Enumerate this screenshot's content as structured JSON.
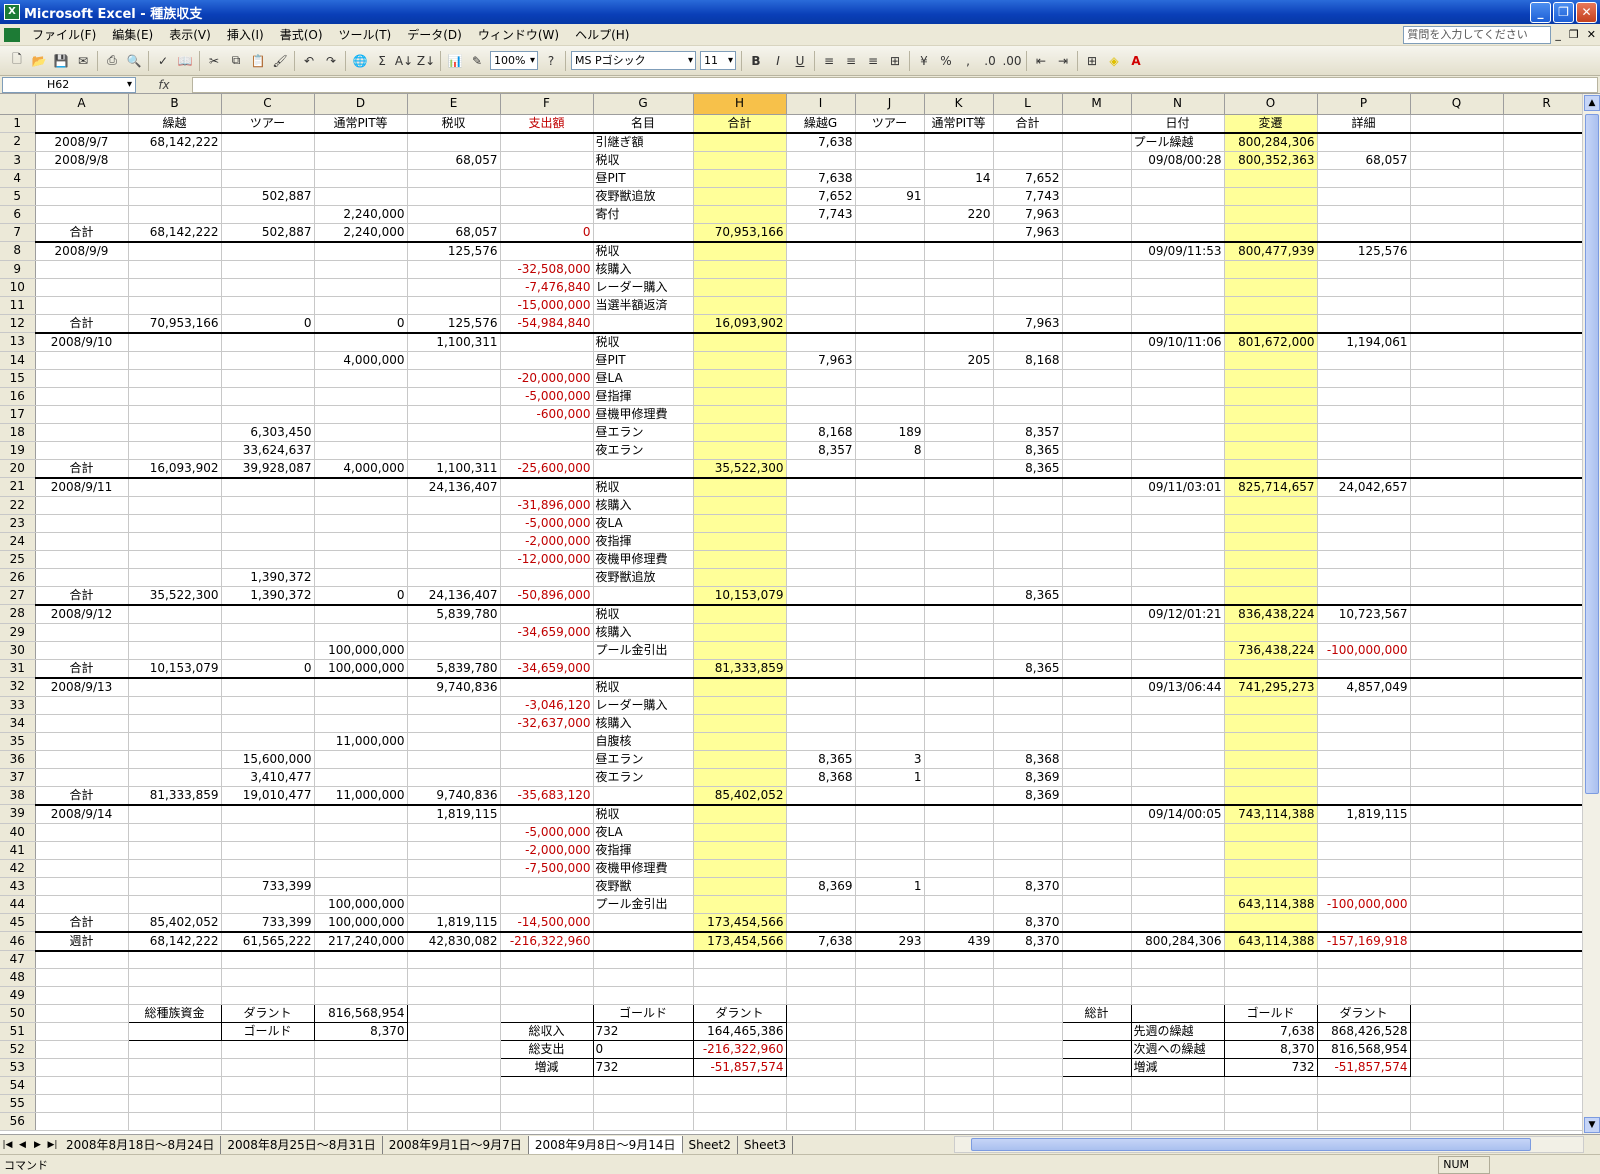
{
  "titlebar": {
    "title": "Microsoft Excel - 種族収支",
    "icon": "excel-icon"
  },
  "menu": [
    "ファイル(F)",
    "編集(E)",
    "表示(V)",
    "挿入(I)",
    "書式(O)",
    "ツール(T)",
    "データ(D)",
    "ウィンドウ(W)",
    "ヘルプ(H)"
  ],
  "help_placeholder": "質問を入力してください",
  "toolbar": {
    "zoom": "100%",
    "font": "MS Pゴシック",
    "font_size": "11",
    "sigma": "Σ",
    "percent": "%",
    "comma": ","
  },
  "namebox": "H62",
  "fx": "fx",
  "columns": [
    "A",
    "B",
    "C",
    "D",
    "E",
    "F",
    "G",
    "H",
    "I",
    "J",
    "K",
    "L",
    "M",
    "N",
    "O",
    "P",
    "Q",
    "R"
  ],
  "rows": [
    {
      "n": 1,
      "A": "",
      "B": "繰越",
      "C": "ツアー",
      "D": "通常PIT等",
      "E": "税収",
      "F": "支出額",
      "G": "名目",
      "H": "合計",
      "I": "繰越G",
      "J": "ツアー",
      "K": "通常PIT等",
      "L": "合計",
      "N": "日付",
      "O": "変遷",
      "P": "詳細"
    },
    {
      "n": 2,
      "A": "2008/9/7",
      "B": "68,142,222",
      "G": "引継ぎ額",
      "I": "7,638",
      "N": "プール繰越",
      "O": "800,284,306"
    },
    {
      "n": 3,
      "A": "2008/9/8",
      "E": "68,057",
      "G": "税収",
      "N": "09/08/00:28",
      "O": "800,352,363",
      "P": "68,057"
    },
    {
      "n": 4,
      "G": "昼PIT",
      "I": "7,638",
      "K": "14",
      "L": "7,652"
    },
    {
      "n": 5,
      "C": "502,887",
      "G": "夜野獣追放",
      "I": "7,652",
      "J": "91",
      "L": "7,743"
    },
    {
      "n": 6,
      "D": "2,240,000",
      "G": "寄付",
      "I": "7,743",
      "K": "220",
      "L": "7,963"
    },
    {
      "n": 7,
      "A": "合計",
      "B": "68,142,222",
      "C": "502,887",
      "D": "2,240,000",
      "E": "68,057",
      "F": "0",
      "H": "70,953,166",
      "L": "7,963"
    },
    {
      "n": 8,
      "A": "2008/9/9",
      "E": "125,576",
      "G": "税収",
      "N": "09/09/11:53",
      "O": "800,477,939",
      "P": "125,576"
    },
    {
      "n": 9,
      "F": "-32,508,000",
      "G": "核購入"
    },
    {
      "n": 10,
      "F": "-7,476,840",
      "G": "レーダー購入"
    },
    {
      "n": 11,
      "F": "-15,000,000",
      "G": "当選半額返済"
    },
    {
      "n": 12,
      "A": "合計",
      "B": "70,953,166",
      "C": "0",
      "D": "0",
      "E": "125,576",
      "F": "-54,984,840",
      "H": "16,093,902",
      "L": "7,963"
    },
    {
      "n": 13,
      "A": "2008/9/10",
      "E": "1,100,311",
      "G": "税収",
      "N": "09/10/11:06",
      "O": "801,672,000",
      "P": "1,194,061"
    },
    {
      "n": 14,
      "D": "4,000,000",
      "G": "昼PIT",
      "I": "7,963",
      "K": "205",
      "L": "8,168"
    },
    {
      "n": 15,
      "F": "-20,000,000",
      "G": "昼LA"
    },
    {
      "n": 16,
      "F": "-5,000,000",
      "G": "昼指揮"
    },
    {
      "n": 17,
      "F": "-600,000",
      "G": "昼機甲修理費"
    },
    {
      "n": 18,
      "C": "6,303,450",
      "G": "昼エラン",
      "I": "8,168",
      "J": "189",
      "L": "8,357"
    },
    {
      "n": 19,
      "C": "33,624,637",
      "G": "夜エラン",
      "I": "8,357",
      "J": "8",
      "L": "8,365"
    },
    {
      "n": 20,
      "A": "合計",
      "B": "16,093,902",
      "C": "39,928,087",
      "D": "4,000,000",
      "E": "1,100,311",
      "F": "-25,600,000",
      "H": "35,522,300",
      "L": "8,365"
    },
    {
      "n": 21,
      "A": "2008/9/11",
      "E": "24,136,407",
      "G": "税収",
      "N": "09/11/03:01",
      "O": "825,714,657",
      "P": "24,042,657"
    },
    {
      "n": 22,
      "F": "-31,896,000",
      "G": "核購入"
    },
    {
      "n": 23,
      "F": "-5,000,000",
      "G": "夜LA"
    },
    {
      "n": 24,
      "F": "-2,000,000",
      "G": "夜指揮"
    },
    {
      "n": 25,
      "F": "-12,000,000",
      "G": "夜機甲修理費"
    },
    {
      "n": 26,
      "C": "1,390,372",
      "G": "夜野獣追放"
    },
    {
      "n": 27,
      "A": "合計",
      "B": "35,522,300",
      "C": "1,390,372",
      "D": "0",
      "E": "24,136,407",
      "F": "-50,896,000",
      "H": "10,153,079",
      "L": "8,365"
    },
    {
      "n": 28,
      "A": "2008/9/12",
      "E": "5,839,780",
      "G": "税収",
      "N": "09/12/01:21",
      "O": "836,438,224",
      "P": "10,723,567"
    },
    {
      "n": 29,
      "F": "-34,659,000",
      "G": "核購入"
    },
    {
      "n": 30,
      "D": "100,000,000",
      "G": "プール金引出",
      "O": "736,438,224",
      "P": "-100,000,000"
    },
    {
      "n": 31,
      "A": "合計",
      "B": "10,153,079",
      "C": "0",
      "D": "100,000,000",
      "E": "5,839,780",
      "F": "-34,659,000",
      "H": "81,333,859",
      "L": "8,365"
    },
    {
      "n": 32,
      "A": "2008/9/13",
      "E": "9,740,836",
      "G": "税収",
      "N": "09/13/06:44",
      "O": "741,295,273",
      "P": "4,857,049"
    },
    {
      "n": 33,
      "F": "-3,046,120",
      "G": "レーダー購入"
    },
    {
      "n": 34,
      "F": "-32,637,000",
      "G": "核購入"
    },
    {
      "n": 35,
      "D": "11,000,000",
      "G": "自腹核"
    },
    {
      "n": 36,
      "C": "15,600,000",
      "G": "昼エラン",
      "I": "8,365",
      "J": "3",
      "L": "8,368"
    },
    {
      "n": 37,
      "C": "3,410,477",
      "G": "夜エラン",
      "I": "8,368",
      "J": "1",
      "L": "8,369"
    },
    {
      "n": 38,
      "A": "合計",
      "B": "81,333,859",
      "C": "19,010,477",
      "D": "11,000,000",
      "E": "9,740,836",
      "F": "-35,683,120",
      "H": "85,402,052",
      "L": "8,369"
    },
    {
      "n": 39,
      "A": "2008/9/14",
      "E": "1,819,115",
      "G": "税収",
      "N": "09/14/00:05",
      "O": "743,114,388",
      "P": "1,819,115"
    },
    {
      "n": 40,
      "F": "-5,000,000",
      "G": "夜LA"
    },
    {
      "n": 41,
      "F": "-2,000,000",
      "G": "夜指揮"
    },
    {
      "n": 42,
      "F": "-7,500,000",
      "G": "夜機甲修理費"
    },
    {
      "n": 43,
      "C": "733,399",
      "G": "夜野獣",
      "I": "8,369",
      "J": "1",
      "L": "8,370"
    },
    {
      "n": 44,
      "D": "100,000,000",
      "G": "プール金引出",
      "O": "643,114,388",
      "P": "-100,000,000"
    },
    {
      "n": 45,
      "A": "合計",
      "B": "85,402,052",
      "C": "733,399",
      "D": "100,000,000",
      "E": "1,819,115",
      "F": "-14,500,000",
      "H": "173,454,566",
      "L": "8,370"
    },
    {
      "n": 46,
      "A": "週計",
      "B": "68,142,222",
      "C": "61,565,222",
      "D": "217,240,000",
      "E": "42,830,082",
      "F": "-216,322,960",
      "H": "173,454,566",
      "I": "7,638",
      "J": "293",
      "K": "439",
      "L": "8,370",
      "N": "800,284,306",
      "O": "643,114,388",
      "P": "-157,169,918"
    },
    {
      "n": 47
    },
    {
      "n": 48
    },
    {
      "n": 49
    },
    {
      "n": 50,
      "B": "総種族資金",
      "C": "ダラント",
      "D": "816,568,954",
      "G": "ゴールド",
      "H": "ダラント",
      "M": "総計",
      "O": "ゴールド",
      "P": "ダラント"
    },
    {
      "n": 51,
      "C": "ゴールド",
      "D": "8,370",
      "F": "総収入",
      "G": "732",
      "H": "164,465,386",
      "N": "先週の繰越",
      "O": "7,638",
      "P": "868,426,528"
    },
    {
      "n": 52,
      "F": "総支出",
      "G": "0",
      "H": "-216,322,960",
      "N": "次週への繰越",
      "O": "8,370",
      "P": "816,568,954"
    },
    {
      "n": 53,
      "F": "増減",
      "G": "732",
      "H": "-51,857,574",
      "N": "増減",
      "O": "732",
      "P": "-51,857,574"
    },
    {
      "n": 54
    },
    {
      "n": 55
    },
    {
      "n": 56
    }
  ],
  "sheet_tabs": [
    "2008年8月18日～8月24日",
    "2008年8月25日～8月31日",
    "2008年9月1日～9月7日",
    "2008年9月8日～9月14日",
    "Sheet2",
    "Sheet3"
  ],
  "active_tab": "2008年9月8日～9月14日",
  "status": {
    "left": "コマンド",
    "num": "NUM"
  }
}
